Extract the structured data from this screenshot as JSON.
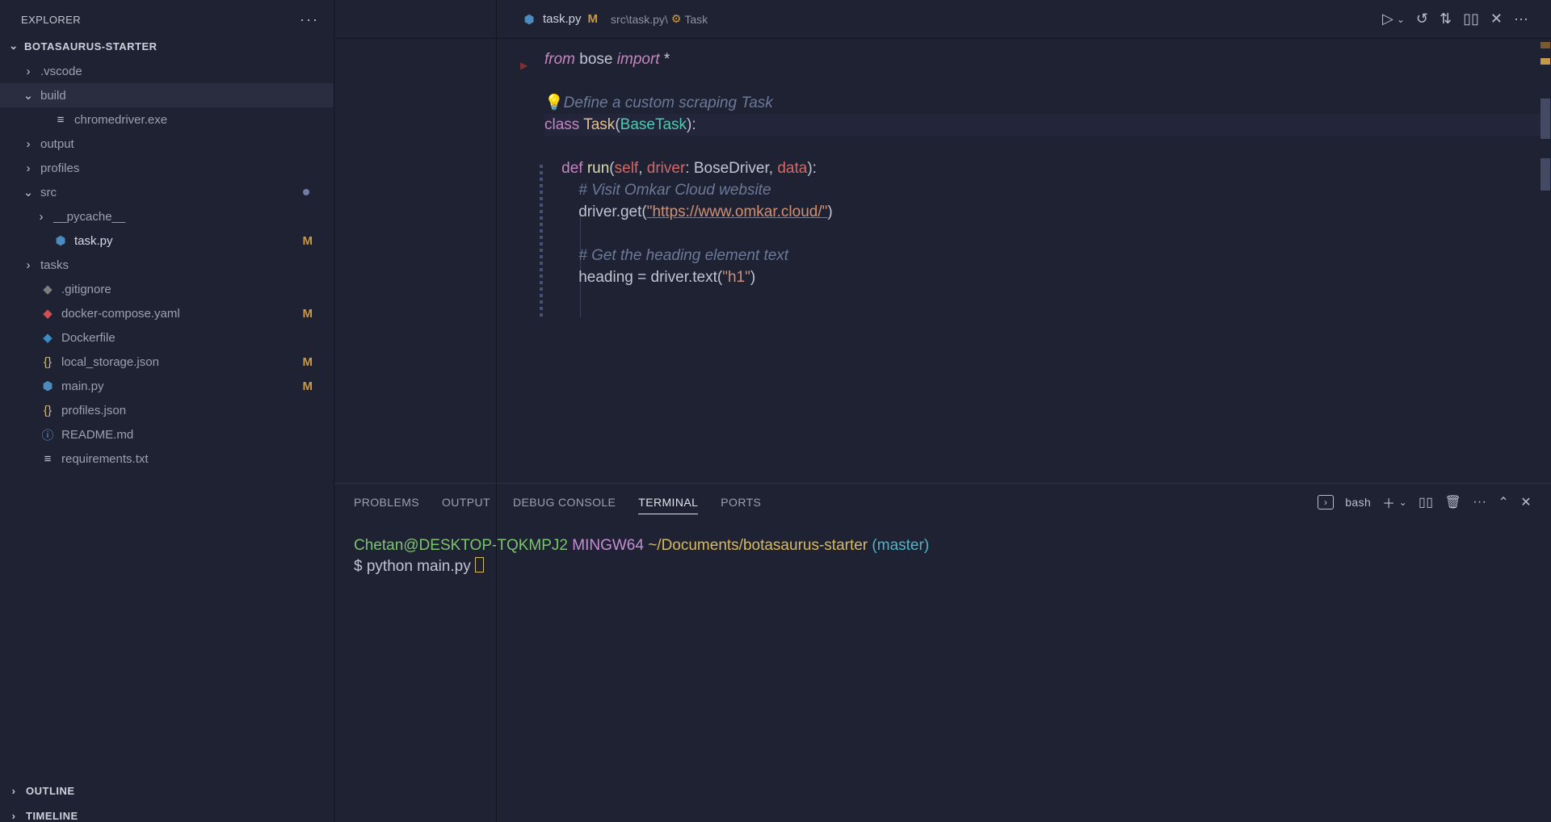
{
  "explorer": {
    "title": "EXPLORER",
    "root": "BOTASAURUS-STARTER",
    "items": [
      {
        "type": "folder",
        "name": ".vscode",
        "open": false,
        "lvl": 1
      },
      {
        "type": "folder",
        "name": "build",
        "open": true,
        "lvl": 1,
        "sel": true
      },
      {
        "type": "file",
        "name": "chromedriver.exe",
        "icon": "txt",
        "lvl": 2
      },
      {
        "type": "folder",
        "name": "output",
        "open": false,
        "lvl": 1
      },
      {
        "type": "folder",
        "name": "profiles",
        "open": false,
        "lvl": 1
      },
      {
        "type": "folder",
        "name": "src",
        "open": true,
        "lvl": 1,
        "dot": true
      },
      {
        "type": "folder",
        "name": "__pycache__",
        "open": false,
        "lvl": 2
      },
      {
        "type": "file",
        "name": "task.py",
        "icon": "py",
        "lvl": 2,
        "mod": "M",
        "active": true
      },
      {
        "type": "folder",
        "name": "tasks",
        "open": false,
        "lvl": 1
      },
      {
        "type": "file",
        "name": ".gitignore",
        "icon": "git",
        "lvl": 1
      },
      {
        "type": "file",
        "name": "docker-compose.yaml",
        "icon": "yaml",
        "lvl": 1,
        "mod": "M"
      },
      {
        "type": "file",
        "name": "Dockerfile",
        "icon": "docker",
        "lvl": 1
      },
      {
        "type": "file",
        "name": "local_storage.json",
        "icon": "json",
        "lvl": 1,
        "mod": "M"
      },
      {
        "type": "file",
        "name": "main.py",
        "icon": "py",
        "lvl": 1,
        "mod": "M"
      },
      {
        "type": "file",
        "name": "profiles.json",
        "icon": "json",
        "lvl": 1
      },
      {
        "type": "file",
        "name": "README.md",
        "icon": "md",
        "lvl": 1
      },
      {
        "type": "file",
        "name": "requirements.txt",
        "icon": "txt",
        "lvl": 1
      }
    ],
    "sections": [
      "OUTLINE",
      "TIMELINE"
    ]
  },
  "tab": {
    "filename": "task.py",
    "mod": "M",
    "breadcrumb_path": "src\\task.py\\",
    "breadcrumb_symbol": "Task"
  },
  "editor": {
    "line_import_from": "from",
    "line_import_mod": " bose ",
    "line_import_kw": "import",
    "line_import_star": " *",
    "cmt_define": "Define a custom scraping Task",
    "class_kw": "class",
    "class_name": " Task",
    "class_base": "BaseTask",
    "def_kw": "def",
    "def_name": " run",
    "def_self": "self",
    "def_driver": "driver",
    "def_type": "BoseDriver",
    "def_data": "data",
    "cmt_visit": "# Visit Omkar Cloud website",
    "driver_get_pre": "driver.get(",
    "driver_get_url": "\"https://www.omkar.cloud/\"",
    "cmt_heading": "# Get the heading element text",
    "heading_lhs": "heading",
    "heading_eq": " = ",
    "heading_call": "driver.text(",
    "heading_arg": "\"h1\"",
    "heading_close": ")"
  },
  "panel": {
    "tabs": [
      "PROBLEMS",
      "OUTPUT",
      "DEBUG CONSOLE",
      "TERMINAL",
      "PORTS"
    ],
    "active_tab": 3,
    "shell_name": "bash"
  },
  "terminal": {
    "user": "Chetan@DESKTOP-TQKMPJ2",
    "sys": " MINGW64 ",
    "path": "~/Documents/botasaurus-starter",
    "branch": " (master)",
    "prompt": "$ ",
    "cmd": "python main.py "
  }
}
